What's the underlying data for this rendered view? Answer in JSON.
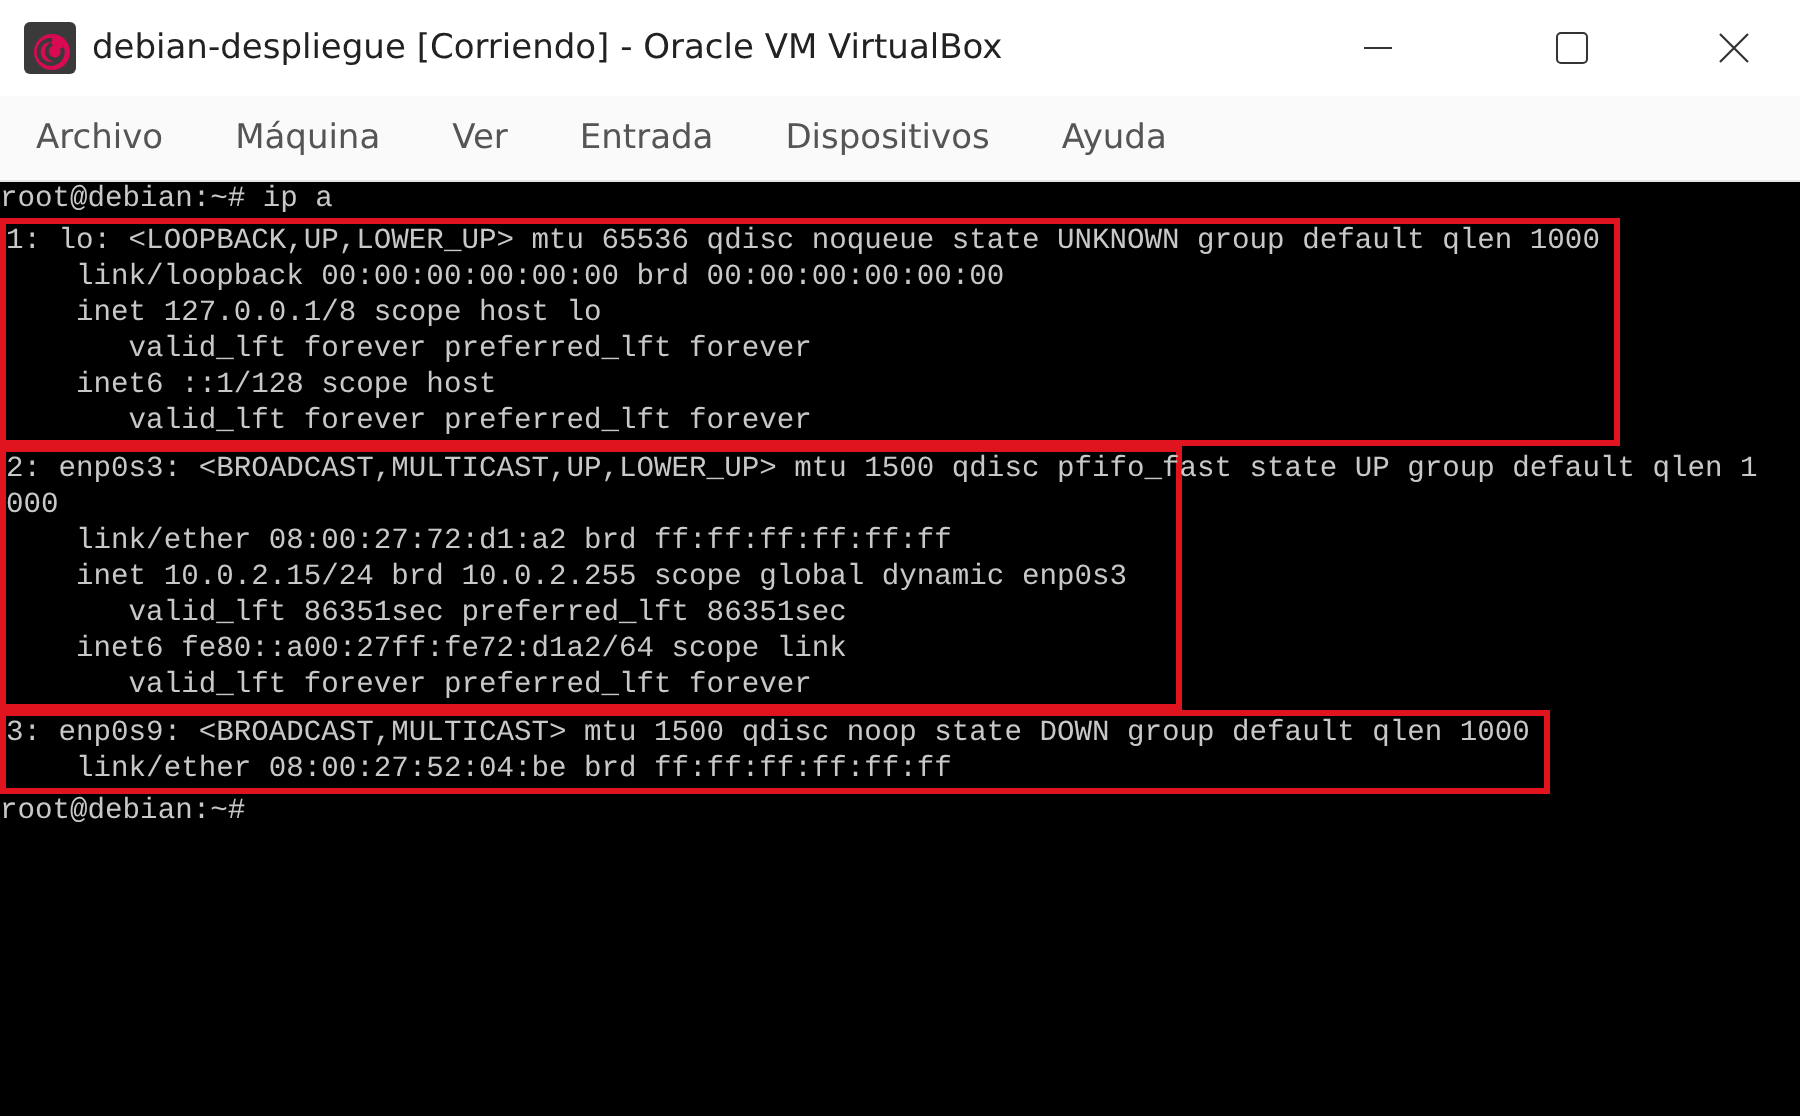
{
  "window": {
    "title": "debian-despliegue [Corriendo] - Oracle VM VirtualBox"
  },
  "menu": [
    "Archivo",
    "Máquina",
    "Ver",
    "Entrada",
    "Dispositivos",
    "Ayuda"
  ],
  "terminal": {
    "blocks": [
      {
        "highlighted": false,
        "lines": [
          "root@debian:~# ip a"
        ]
      },
      {
        "highlighted": true,
        "lines": [
          "1: lo: <LOOPBACK,UP,LOWER_UP> mtu 65536 qdisc noqueue state UNKNOWN group default qlen 1000",
          "    link/loopback 00:00:00:00:00:00 brd 00:00:00:00:00:00",
          "    inet 127.0.0.1/8 scope host lo",
          "       valid_lft forever preferred_lft forever",
          "    inet6 ::1/128 scope host",
          "       valid_lft forever preferred_lft forever"
        ]
      },
      {
        "highlighted": true,
        "lines": [
          "2: enp0s3: <BROADCAST,MULTICAST,UP,LOWER_UP> mtu 1500 qdisc pfifo_fast state UP group default qlen 1",
          "000",
          "    link/ether 08:00:27:72:d1:a2 brd ff:ff:ff:ff:ff:ff",
          "    inet 10.0.2.15/24 brd 10.0.2.255 scope global dynamic enp0s3",
          "       valid_lft 86351sec preferred_lft 86351sec",
          "    inet6 fe80::a00:27ff:fe72:d1a2/64 scope link",
          "       valid_lft forever preferred_lft forever"
        ]
      },
      {
        "highlighted": true,
        "lines": [
          "3: enp0s9: <BROADCAST,MULTICAST> mtu 1500 qdisc noop state DOWN group default qlen 1000",
          "    link/ether 08:00:27:52:04:be brd ff:ff:ff:ff:ff:ff"
        ]
      },
      {
        "highlighted": false,
        "lines": [
          "root@debian:~#"
        ]
      }
    ]
  }
}
